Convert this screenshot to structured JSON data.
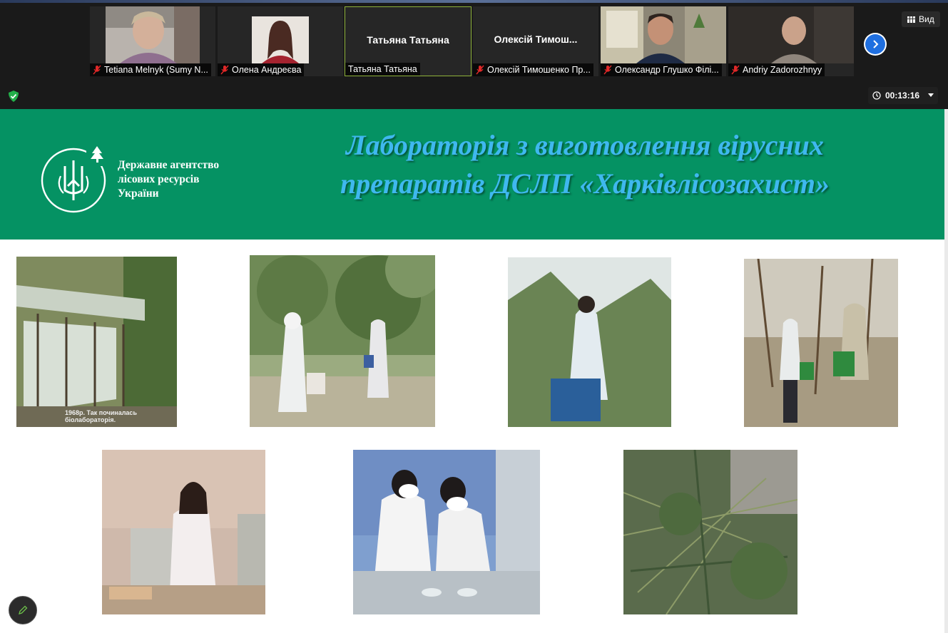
{
  "participants": [
    {
      "display_name": "Tetiana Melnyk (Sumy N...",
      "muted": true,
      "has_video": true
    },
    {
      "display_name": "Олена Андреєва",
      "muted": true,
      "has_video": true
    },
    {
      "display_name": "Татьяна Татьяна",
      "center_name": "Татьяна Татьяна",
      "muted": false,
      "has_video": false,
      "active": true
    },
    {
      "display_name": "Олексій Тимошенко Пр...",
      "center_name": "Олексій  Тимош...",
      "muted": true,
      "has_video": false
    },
    {
      "display_name": "Олександр Глушко Філі...",
      "muted": true,
      "has_video": true
    },
    {
      "display_name": "Andriy Zadorozhnyy",
      "muted": true,
      "has_video": true
    }
  ],
  "toolbar": {
    "view_label": "Вид",
    "timer": "00:13:16",
    "next_icon": "chevron-right-icon",
    "security_icon": "shield-check-icon"
  },
  "slide": {
    "agency_lines": [
      "Державне агентство",
      "лісових ресурсів",
      "України"
    ],
    "title_lines": [
      "Лабораторія з виготовлення вірусних",
      "препаратів ДСЛП «Харківлісозахист»"
    ],
    "first_photo_caption": "1968р. Так починалась біолабораторія.",
    "banner_color": "#059263",
    "title_color": "#3fb8ef"
  },
  "edit_button_icon": "pencil-icon"
}
